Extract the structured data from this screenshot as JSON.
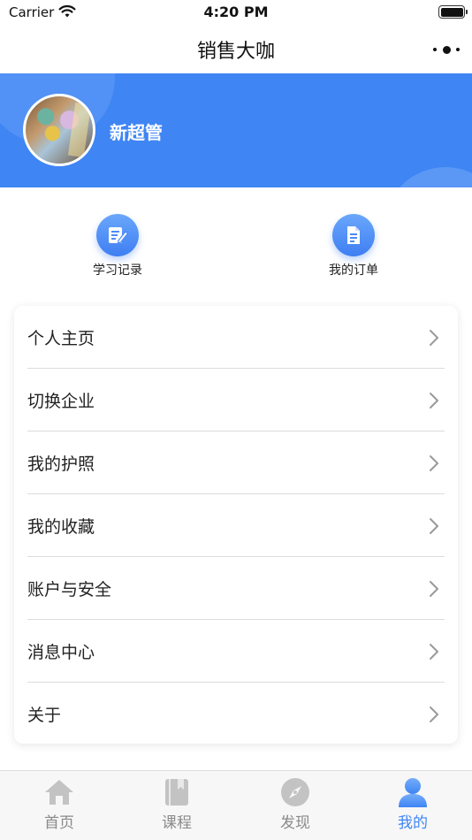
{
  "status_bar": {
    "carrier": "Carrier",
    "time": "4:20 PM",
    "battery_level": 1.0
  },
  "nav": {
    "title": "销售大咖",
    "more_icon": "more-dots-icon"
  },
  "profile": {
    "username": "新超管",
    "avatar_icon": "user-avatar"
  },
  "quick_actions": [
    {
      "label": "学习记录",
      "icon": "edit-note-icon"
    },
    {
      "label": "我的订单",
      "icon": "document-icon"
    }
  ],
  "menu": {
    "items": [
      {
        "label": "个人主页"
      },
      {
        "label": "切换企业"
      },
      {
        "label": "我的护照"
      },
      {
        "label": "我的收藏"
      },
      {
        "label": "账户与安全"
      },
      {
        "label": "消息中心"
      },
      {
        "label": "关于"
      }
    ]
  },
  "tabs": [
    {
      "label": "首页",
      "icon": "home-icon",
      "active": false
    },
    {
      "label": "课程",
      "icon": "book-icon",
      "active": false
    },
    {
      "label": "发现",
      "icon": "compass-icon",
      "active": false
    },
    {
      "label": "我的",
      "icon": "person-icon",
      "active": true
    }
  ],
  "colors": {
    "accent": "#3f85f4",
    "tab_inactive": "#8a8a8a",
    "icon_inactive": "#c3c3c3"
  }
}
